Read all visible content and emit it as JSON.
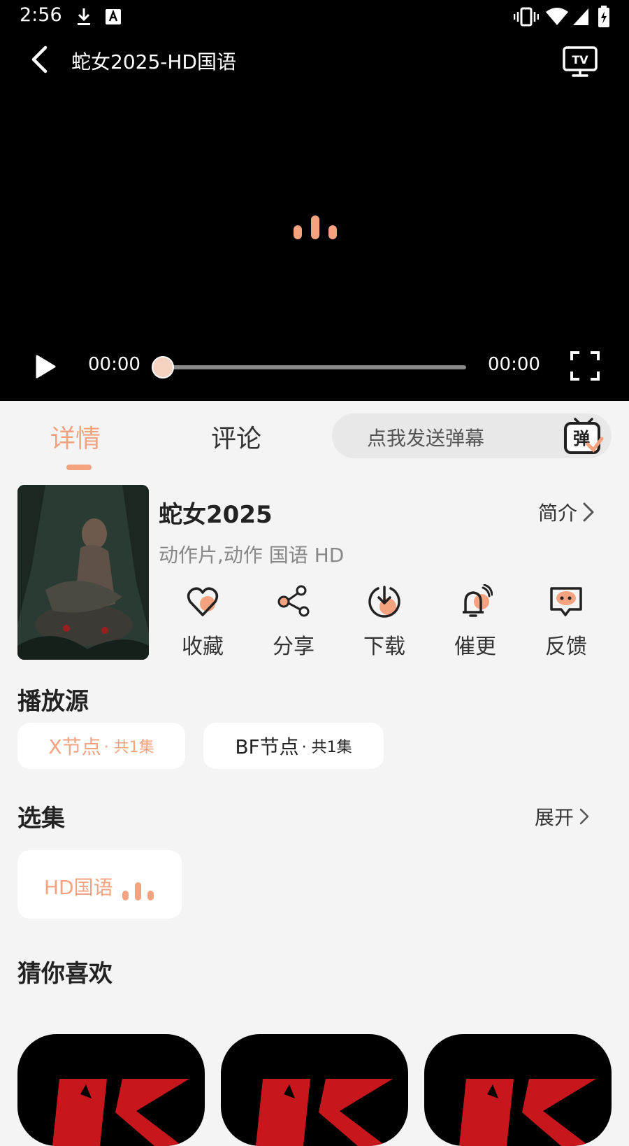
{
  "status_bar": {
    "time": "2:56",
    "icons": [
      "download-icon",
      "a-icon",
      "vibrate-icon",
      "wifi-icon",
      "signal-icon",
      "battery-icon"
    ]
  },
  "player": {
    "title": "蛇女2025-HD国语",
    "current_time": "00:00",
    "total_time": "00:00",
    "progress": 0
  },
  "tabs": [
    {
      "label": "详情",
      "active": true
    },
    {
      "label": "评论",
      "active": false
    }
  ],
  "danmaku": {
    "placeholder": "点我发送弹幕",
    "icon_text": "弹"
  },
  "movie": {
    "title": "蛇女2025",
    "meta": "动作片,动作 国语 HD",
    "intro_label": "简介"
  },
  "actions": [
    {
      "label": "收藏",
      "icon": "heart-icon"
    },
    {
      "label": "分享",
      "icon": "share-icon"
    },
    {
      "label": "下载",
      "icon": "download-icon"
    },
    {
      "label": "催更",
      "icon": "bell-icon"
    },
    {
      "label": "反馈",
      "icon": "feedback-icon"
    }
  ],
  "sources": {
    "title": "播放源",
    "items": [
      {
        "name": "X节点",
        "sub": "· 共1集",
        "selected": true
      },
      {
        "name": "BF节点",
        "sub": "· 共1集",
        "selected": false
      }
    ]
  },
  "episodes": {
    "title": "选集",
    "expand_label": "展开",
    "items": [
      {
        "label": "HD国语",
        "playing": true
      }
    ]
  },
  "recommend": {
    "title": "猜你喜欢"
  },
  "colors": {
    "accent": "#f4a27f",
    "background": "#f4f4f4",
    "player_bg": "#000000"
  }
}
